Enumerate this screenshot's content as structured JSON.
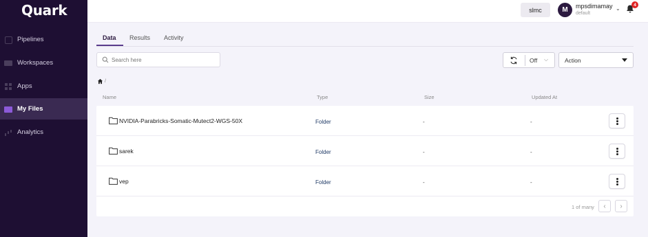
{
  "app": {
    "logo": "Quark"
  },
  "sidebar": {
    "items": [
      {
        "label": "Pipelines",
        "icon": "pipelines-icon"
      },
      {
        "label": "Workspaces",
        "icon": "workspaces-icon"
      },
      {
        "label": "Apps",
        "icon": "apps-icon"
      },
      {
        "label": "My Files",
        "icon": "files-icon",
        "active": true
      },
      {
        "label": "Analytics",
        "icon": "analytics-icon"
      }
    ]
  },
  "topbar": {
    "org": "slmc",
    "avatar_initial": "M",
    "username": "mpsdimamay",
    "role": "default",
    "notification_count": "4"
  },
  "tabs": [
    {
      "label": "Data",
      "active": true
    },
    {
      "label": "Results"
    },
    {
      "label": "Activity"
    }
  ],
  "search": {
    "placeholder": "Search here"
  },
  "refresh": {
    "value": "Off"
  },
  "action": {
    "label": "Action"
  },
  "breadcrumb": {
    "separator": "/"
  },
  "table": {
    "headers": {
      "name": "Name",
      "type": "Type",
      "size": "Size",
      "updated": "Updated At"
    },
    "rows": [
      {
        "name": "NVIDIA-Parabricks-Somatic-Mutect2-WGS-50X",
        "type": "Folder",
        "size": "-",
        "updated": "-"
      },
      {
        "name": "sarek",
        "type": "Folder",
        "size": "-",
        "updated": "-"
      },
      {
        "name": "vep",
        "type": "Folder",
        "size": "-",
        "updated": "-"
      }
    ]
  },
  "pagination": {
    "text": "1 of many",
    "prev": "‹",
    "next": "›"
  },
  "colors": {
    "sidebar_bg": "#1e0f33",
    "accent": "#5a3c8c",
    "badge": "#e02424"
  }
}
